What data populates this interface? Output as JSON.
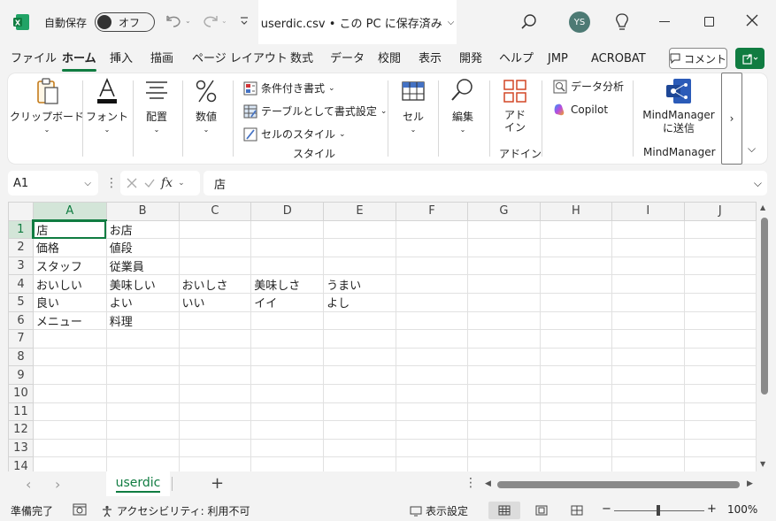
{
  "titlebar": {
    "autosave_label": "自動保存",
    "autosave_state": "オフ",
    "document_title": "userdic.csv • この PC に保存済み",
    "user_initials": "YS"
  },
  "menu": {
    "tabs": [
      "ファイル",
      "ホーム",
      "挿入",
      "描画",
      "ページ レイアウト",
      "数式",
      "データ",
      "校閲",
      "表示",
      "開発",
      "ヘルプ",
      "JMP",
      "ACROBAT"
    ],
    "active_tab": "ホーム",
    "comment_label": "コメント"
  },
  "ribbon": {
    "clipboard": "クリップボード",
    "font": "フォント",
    "alignment": "配置",
    "number": "数値",
    "conditional_format": "条件付き書式",
    "format_as_table": "テーブルとして書式設定",
    "cell_styles": "セルのスタイル",
    "styles_group": "スタイル",
    "cells": "セル",
    "editing": "編集",
    "addins_line1": "アド",
    "addins_line2": "イン",
    "addins_group": "アドイン",
    "data_analysis": "データ分析",
    "copilot": "Copilot",
    "mindmanager_line1": "MindManager",
    "mindmanager_line2": "に送信",
    "mindmanager_group": "MindManager"
  },
  "formula_bar": {
    "name_box": "A1",
    "fx_label": "fx",
    "content": "店"
  },
  "grid": {
    "columns": [
      "A",
      "B",
      "C",
      "D",
      "E",
      "F",
      "G",
      "H",
      "I",
      "J"
    ],
    "rows": [
      [
        "店",
        "お店",
        "",
        "",
        "",
        "",
        "",
        "",
        "",
        ""
      ],
      [
        "価格",
        "値段",
        "",
        "",
        "",
        "",
        "",
        "",
        "",
        ""
      ],
      [
        "スタッフ",
        "従業員",
        "",
        "",
        "",
        "",
        "",
        "",
        "",
        ""
      ],
      [
        "おいしい",
        "美味しい",
        "おいしさ",
        "美味しさ",
        "うまい",
        "",
        "",
        "",
        "",
        ""
      ],
      [
        "良い",
        "よい",
        "いい",
        "イイ",
        "よし",
        "",
        "",
        "",
        "",
        ""
      ],
      [
        "メニュー",
        "料理",
        "",
        "",
        "",
        "",
        "",
        "",
        "",
        ""
      ],
      [
        "",
        "",
        "",
        "",
        "",
        "",
        "",
        "",
        "",
        ""
      ],
      [
        "",
        "",
        "",
        "",
        "",
        "",
        "",
        "",
        "",
        ""
      ],
      [
        "",
        "",
        "",
        "",
        "",
        "",
        "",
        "",
        "",
        ""
      ],
      [
        "",
        "",
        "",
        "",
        "",
        "",
        "",
        "",
        "",
        ""
      ],
      [
        "",
        "",
        "",
        "",
        "",
        "",
        "",
        "",
        "",
        ""
      ],
      [
        "",
        "",
        "",
        "",
        "",
        "",
        "",
        "",
        "",
        ""
      ],
      [
        "",
        "",
        "",
        "",
        "",
        "",
        "",
        "",
        "",
        ""
      ],
      [
        "",
        "",
        "",
        "",
        "",
        "",
        "",
        "",
        "",
        ""
      ]
    ],
    "row_numbers": [
      "1",
      "2",
      "3",
      "4",
      "5",
      "6",
      "7",
      "8",
      "9",
      "10",
      "11",
      "12",
      "13",
      "14"
    ]
  },
  "sheets": {
    "active": "userdic",
    "add_label": "+"
  },
  "statusbar": {
    "ready": "準備完了",
    "accessibility": "アクセシビリティ: 利用不可",
    "display_settings": "表示設定",
    "zoom_minus": "−",
    "zoom_plus": "+",
    "zoom": "100%"
  },
  "colors": {
    "accent": "#107c41",
    "selection_header": "#d3e5d8"
  }
}
